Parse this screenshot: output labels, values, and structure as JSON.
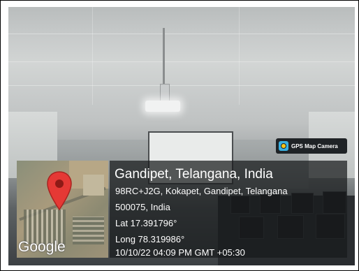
{
  "badge": {
    "label": "GPS Map Camera",
    "icon": "gps-map-camera-icon"
  },
  "map": {
    "provider_label": "Google",
    "pin_icon": "location-pin-icon",
    "pin_color": "#e53935"
  },
  "location": {
    "title": "Gandipet, Telangana, India",
    "address_line1": "98RC+J2G, Kokapet, Gandipet, Telangana",
    "address_line2": "500075, India",
    "lat": "Lat 17.391796°",
    "long": "Long 78.319986°",
    "datetime": "10/10/22 04:09 PM GMT +05:30"
  }
}
